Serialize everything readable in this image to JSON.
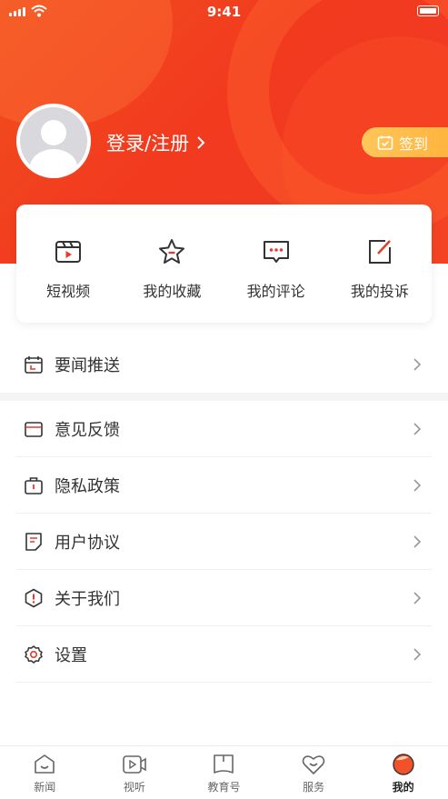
{
  "status": {
    "time": "9:41"
  },
  "profile": {
    "login_label": "登录/注册",
    "signin_label": "签到"
  },
  "quick": [
    {
      "label": "短视频",
      "icon": "video-clip-icon"
    },
    {
      "label": "我的收藏",
      "icon": "star-icon"
    },
    {
      "label": "我的评论",
      "icon": "comment-icon"
    },
    {
      "label": "我的投诉",
      "icon": "edit-icon"
    }
  ],
  "menu": {
    "news_push": "要闻推送",
    "feedback": "意见反馈",
    "privacy": "隐私政策",
    "agreement": "用户协议",
    "about": "关于我们",
    "settings": "设置"
  },
  "tabs": [
    {
      "label": "新闻",
      "icon": "news-icon"
    },
    {
      "label": "视听",
      "icon": "play-icon"
    },
    {
      "label": "教育号",
      "icon": "book-icon"
    },
    {
      "label": "服务",
      "icon": "heart-icon"
    },
    {
      "label": "我的",
      "icon": "profile-icon",
      "active": true
    }
  ],
  "colors": {
    "accent": "#f23a1f",
    "gold": "#ffb23a",
    "icon": "#333333"
  }
}
